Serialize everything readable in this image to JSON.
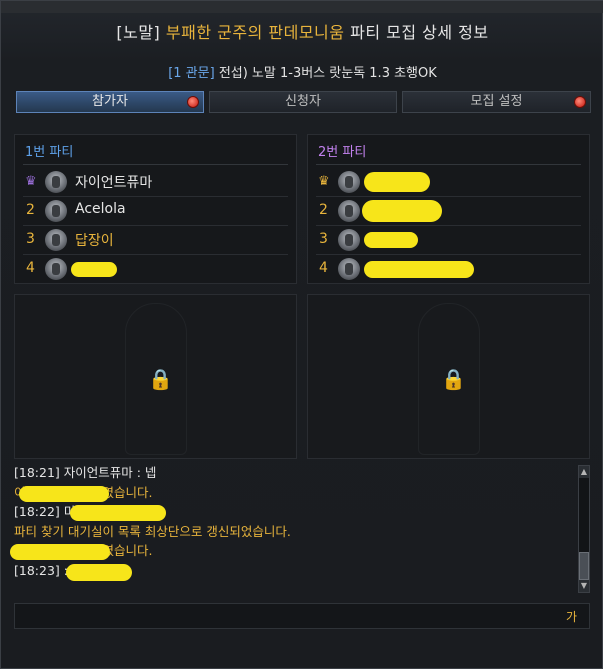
{
  "window": {
    "title_tag": "[노말]",
    "title_raid": "부패한 군주의 판데모니움",
    "title_rest": "파티 모집 상세 정보"
  },
  "recruit": {
    "tag": "[1 관문]",
    "text": "전섭) 노말 1-3버스 랏눈독 1.3 초행OK"
  },
  "tabs": [
    {
      "label": "참가자",
      "active": true,
      "badge": true
    },
    {
      "label": "신청자",
      "active": false,
      "badge": false
    },
    {
      "label": "모집 설정",
      "active": false,
      "badge": true
    }
  ],
  "party1": {
    "header": "1번 파티",
    "members": [
      {
        "rank": "",
        "leader": true,
        "name": "자이언트퓨마",
        "gold": false
      },
      {
        "rank": "2",
        "leader": false,
        "name": "Acelola",
        "gold": false
      },
      {
        "rank": "3",
        "leader": false,
        "name": "답장이",
        "gold": true
      },
      {
        "rank": "4",
        "leader": false,
        "name": "",
        "gold": false
      }
    ]
  },
  "party2": {
    "header": "2번 파티",
    "members": [
      {
        "rank": "",
        "leader": true,
        "name": ""
      },
      {
        "rank": "2",
        "leader": false,
        "name": ""
      },
      {
        "rank": "3",
        "leader": false,
        "name": ""
      },
      {
        "rank": "4",
        "leader": false,
        "name": ""
      }
    ]
  },
  "chat": [
    {
      "text": "[18:21] 자이언트퓨마 : 넵",
      "color": "white"
    },
    {
      "text": "             이 모집에 참여하였습니다.",
      "color": "gold"
    },
    {
      "text": "[18:22]                         미참이요",
      "color": "white"
    },
    {
      "text": "파티 찾기 대기실이 목록 최상단으로 갱신되었습니다.",
      "color": "gold"
    },
    {
      "text": "              이 모집에 참여하였습니다.",
      "color": "gold"
    },
    {
      "text": "[18:23]                    : 눈독이요",
      "color": "white"
    }
  ],
  "input": {
    "ime": "가"
  },
  "colors": {
    "gold": "#e8b43c",
    "party1": "#5ea1ea",
    "party2": "#c382ef",
    "redact": "#f7e51a"
  }
}
